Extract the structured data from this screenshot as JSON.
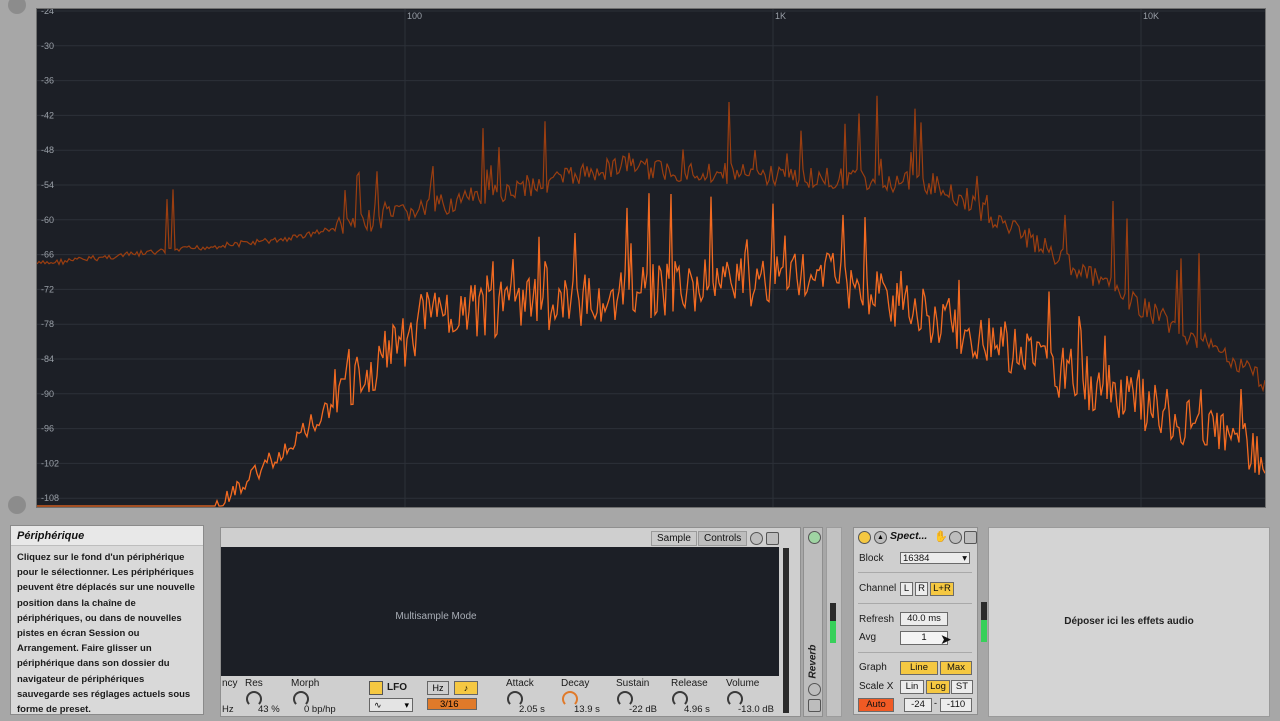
{
  "spectrum": {
    "db_labels": [
      "-24",
      "-30",
      "-36",
      "-42",
      "-48",
      "-54",
      "-60",
      "-66",
      "-72",
      "-78",
      "-84",
      "-90",
      "-96",
      "-102",
      "-108"
    ],
    "freq_labels": [
      "100",
      "1K",
      "10K"
    ],
    "colors": {
      "background": "#1c1f26",
      "line_bright": "#f26a21",
      "line_dim": "#9b3e10",
      "grid": "#2c3038"
    }
  },
  "info": {
    "title": "Périphérique",
    "lines": [
      "Cliquez sur le fond d'un périphérique",
      "pour le sélectionner. Les périphériques",
      "peuvent être déplacés sur une nouvelle",
      "position dans la chaîne de",
      "périphériques, ou dans de nouvelles",
      "pistes en écran Session ou",
      "Arrangement. Faire glisser un",
      "périphérique dans son dossier du",
      "navigateur de périphériques",
      "sauvegarde ses réglages actuels sous",
      "forme de preset."
    ]
  },
  "instrument": {
    "tabs": [
      "Sample",
      "Controls"
    ],
    "display_text": "Multisample Mode",
    "params": {
      "ncy_label": "ncy",
      "hz_value": "Hz",
      "res_label": "Res",
      "res_value": "43 %",
      "morph_label": "Morph",
      "morph_value": "0 bp/hp",
      "lfo_label": "LFO",
      "hz_btn": "Hz",
      "note_btn": "♪",
      "rate_value": "3/16",
      "attack_label": "Attack",
      "attack_value": "2.05 s",
      "decay_label": "Decay",
      "decay_value": "13.9 s",
      "sustain_label": "Sustain",
      "sustain_value": "-22 dB",
      "release_label": "Release",
      "release_value": "4.96 s",
      "volume_label": "Volume",
      "volume_value": "-13.0 dB"
    }
  },
  "reverb": {
    "label": "Reverb"
  },
  "spectrum_device": {
    "title": "Spect...",
    "block_label": "Block",
    "block_value": "16384",
    "channel_label": "Channel",
    "channel_opts": [
      "L",
      "R",
      "L+R"
    ],
    "refresh_label": "Refresh",
    "refresh_value": "40.0 ms",
    "avg_label": "Avg",
    "avg_value": "1",
    "graph_label": "Graph",
    "graph_opts": [
      "Line",
      "Max"
    ],
    "scalex_label": "Scale X",
    "scalex_opts": [
      "Lin",
      "Log",
      "ST"
    ],
    "auto_label": "Auto",
    "range_min": "-24",
    "range_max": "-110"
  },
  "drop_zone": {
    "text": "Déposer ici les effets audio"
  }
}
